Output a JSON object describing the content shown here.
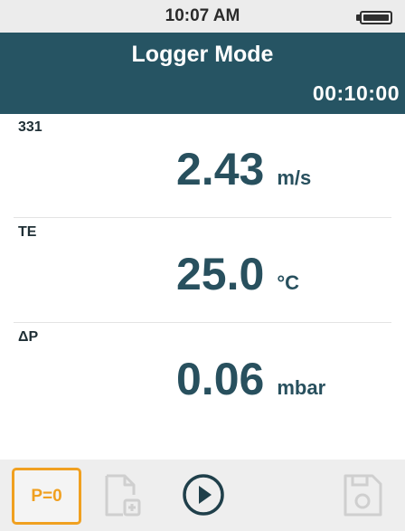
{
  "status_bar": {
    "time": "10:07 AM",
    "battery_icon": "battery-full-icon"
  },
  "header": {
    "title": "Logger Mode",
    "timer": "00:10:00",
    "color": "#265463"
  },
  "measurements": [
    {
      "label": "331",
      "value": "2.43",
      "unit": "m/s"
    },
    {
      "label": "TE",
      "value": "25.0",
      "unit": "°C"
    },
    {
      "label": "ΔP",
      "value": "0.06",
      "unit": "mbar"
    }
  ],
  "toolbar": {
    "zero_label": "P=0",
    "zero_color": "#f0a020",
    "icons": [
      "add-document-icon",
      "play-icon",
      "save-icon"
    ]
  },
  "colors": {
    "value_text": "#28505e",
    "status_bar_bg": "#ececec",
    "toolbar_bg": "#eeeeee"
  }
}
